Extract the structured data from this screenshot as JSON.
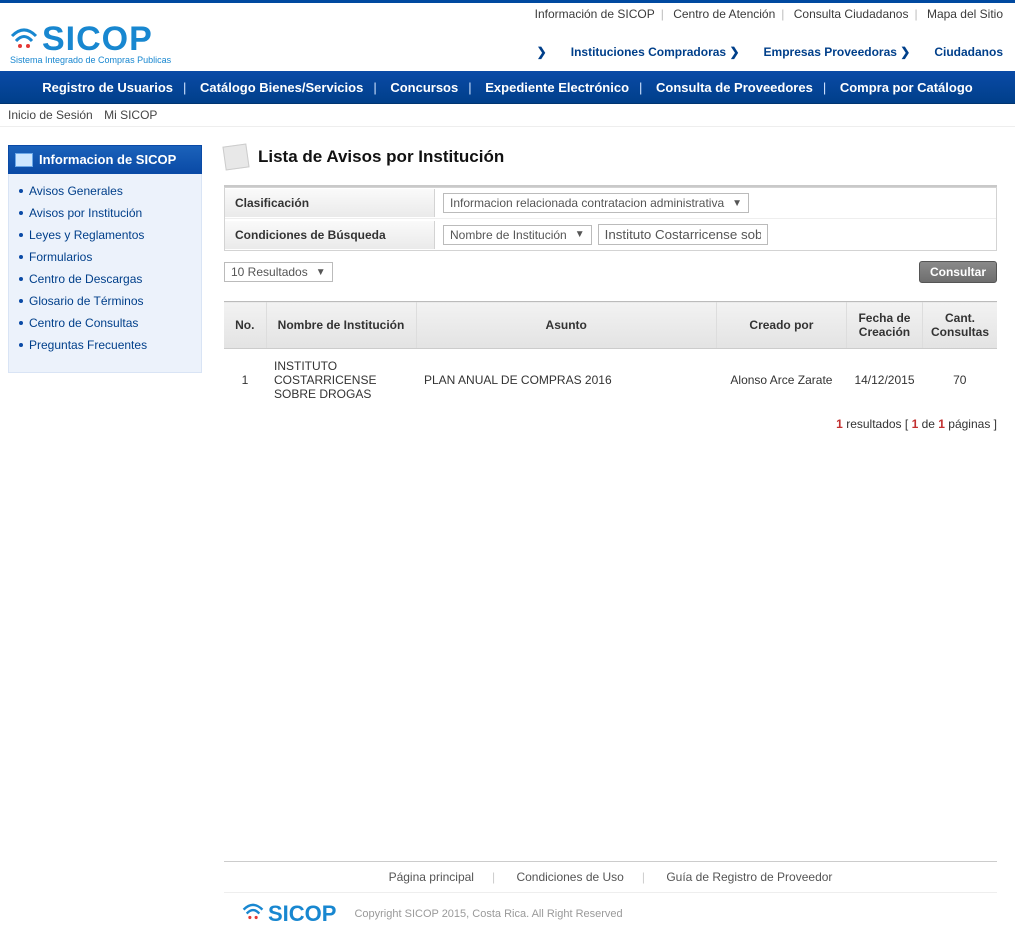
{
  "top_links": [
    "Información de SICOP",
    "Centro de Atención",
    "Consulta Ciudadanos",
    "Mapa del Sitio"
  ],
  "logo": {
    "name": "SICOP",
    "tagline": "Sistema Integrado de Compras Publicas"
  },
  "sub_links": [
    "Instituciones Compradoras",
    "Empresas Proveedoras",
    "Ciudadanos"
  ],
  "main_nav": [
    "Registro de Usuarios",
    "Catálogo Bienes/Servicios",
    "Concursos",
    "Expediente Electrónico",
    "Consulta de Proveedores",
    "Compra por Catálogo"
  ],
  "breadcrumb": [
    "Inicio de Sesión",
    "Mi SICOP"
  ],
  "sidebar": {
    "title": "Informacion de SICOP",
    "items": [
      "Avisos Generales",
      "Avisos por Institución",
      "Leyes y Reglamentos",
      "Formularios",
      "Centro de Descargas",
      "Glosario de Términos",
      "Centro de Consultas",
      "Preguntas Frecuentes"
    ]
  },
  "page_title": "Lista de Avisos por Institución",
  "filters": {
    "row1_label": "Clasificación",
    "row1_value": "Informacion relacionada contratacion administrativa",
    "row2_label": "Condiciones de Búsqueda",
    "row2_select": "Nombre de Institución",
    "row2_input": "Instituto Costarricense sobre D"
  },
  "page_size": "10 Resultados",
  "consult_btn": "Consultar",
  "table": {
    "headers": [
      "No.",
      "Nombre de Institución",
      "Asunto",
      "Creado por",
      "Fecha de Creación",
      "Cant. Consultas"
    ],
    "rows": [
      {
        "no": "1",
        "inst": "INSTITUTO COSTARRICENSE SOBRE DROGAS",
        "asunto": "PLAN ANUAL DE COMPRAS 2016",
        "creador": "Alonso Arce Zarate",
        "fecha": "14/12/2015",
        "cant": "70"
      }
    ]
  },
  "pager": {
    "count": "1",
    "text_results": " resultados [ ",
    "page_cur": "1",
    "page_mid": " de ",
    "page_tot": "1",
    "text_tail": " páginas ]"
  },
  "footer_links": [
    "Página principal",
    "Condiciones de Uso",
    "Guía de Registro de Proveedor"
  ],
  "copyright": "Copyright SICOP 2015, Costa Rica. All Right Reserved"
}
